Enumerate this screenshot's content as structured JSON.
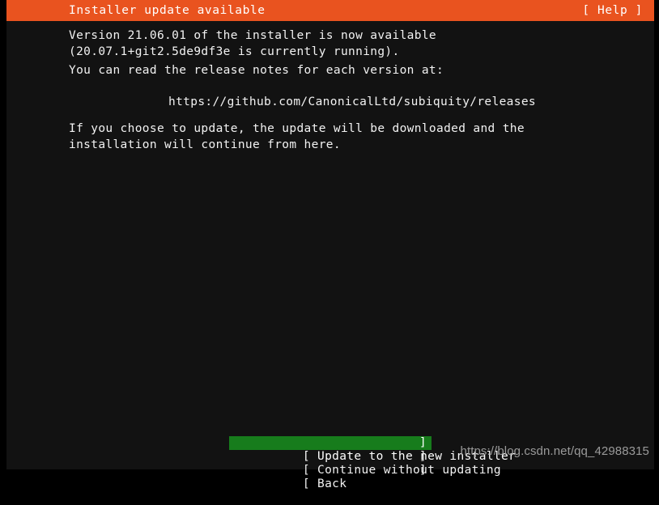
{
  "header": {
    "title": "Installer update available",
    "help_label": "[ Help ]",
    "background_color": "#e9531f",
    "text_color": "#ffffff"
  },
  "screen": {
    "background_color": "#121212",
    "border_color": "#000000",
    "text_color": "#f2f2f2"
  },
  "content": {
    "paragraph_version": "Version 21.06.01 of the installer is now available (20.07.1+git2.5de9df3e is currently running).",
    "paragraph_notes": "You can read the release notes for each version at:",
    "release_notes_url": "https://github.com/CanonicalLtd/subiquity/releases",
    "paragraph_choose": "If you choose to update, the update will be downloaded and the installation will continue from here."
  },
  "menu": {
    "selected_index": 0,
    "highlight_color": "#177c1c",
    "items": [
      {
        "bracket_left": "[",
        "label": " Update to the new installer ",
        "bracket_right": "]",
        "selected": true
      },
      {
        "bracket_left": "[",
        "label": " Continue without updating",
        "bracket_right": "]",
        "selected": false
      },
      {
        "bracket_left": "[",
        "label": " Back",
        "bracket_right": "]",
        "selected": false
      }
    ]
  },
  "watermark": {
    "text": "https://blog.csdn.net/qq_42988315",
    "color": "#9a9a9a"
  }
}
